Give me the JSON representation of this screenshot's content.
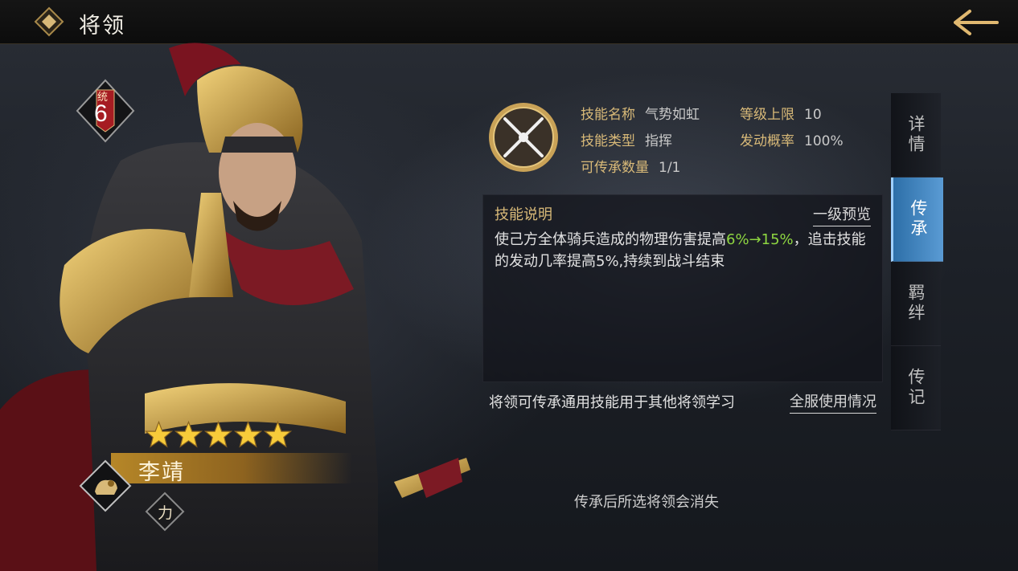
{
  "header": {
    "title": "将领"
  },
  "hero": {
    "rank_label": "统",
    "rank_value": "6",
    "stars": 5,
    "name": "李靖",
    "attribute": "力",
    "class_icon": "lion-icon"
  },
  "skill": {
    "rows": [
      {
        "label": "技能名称",
        "value": "气势如虹"
      },
      {
        "label": "等级上限",
        "value": "10"
      },
      {
        "label": "技能类型",
        "value": "指挥"
      },
      {
        "label": "发动概率",
        "value": "100%"
      },
      {
        "label": "可传承数量",
        "value": "1/1"
      }
    ],
    "icon": "crossed-blades-icon"
  },
  "description": {
    "title": "技能说明",
    "preview_link": "一级预览",
    "text_before": "使己方全体骑兵造成的物理伤害提高",
    "highlight": "6%→15%",
    "text_after": "，追击技能的发动几率提高5%,持续到战斗结束",
    "highlight_color": "#8ed641"
  },
  "footer": {
    "inherit_note": "将领可传承通用技能用于其他将领学习",
    "server_usage_link": "全服使用情况",
    "bottom_note": "传承后所选将领会消失"
  },
  "tabs": [
    {
      "label": "详情",
      "active": false
    },
    {
      "label": "传承",
      "active": true
    },
    {
      "label": "羁绊",
      "active": false
    },
    {
      "label": "传记",
      "active": false
    }
  ],
  "colors": {
    "gold": "#d8b978",
    "tab_active": "#3d84c4"
  }
}
